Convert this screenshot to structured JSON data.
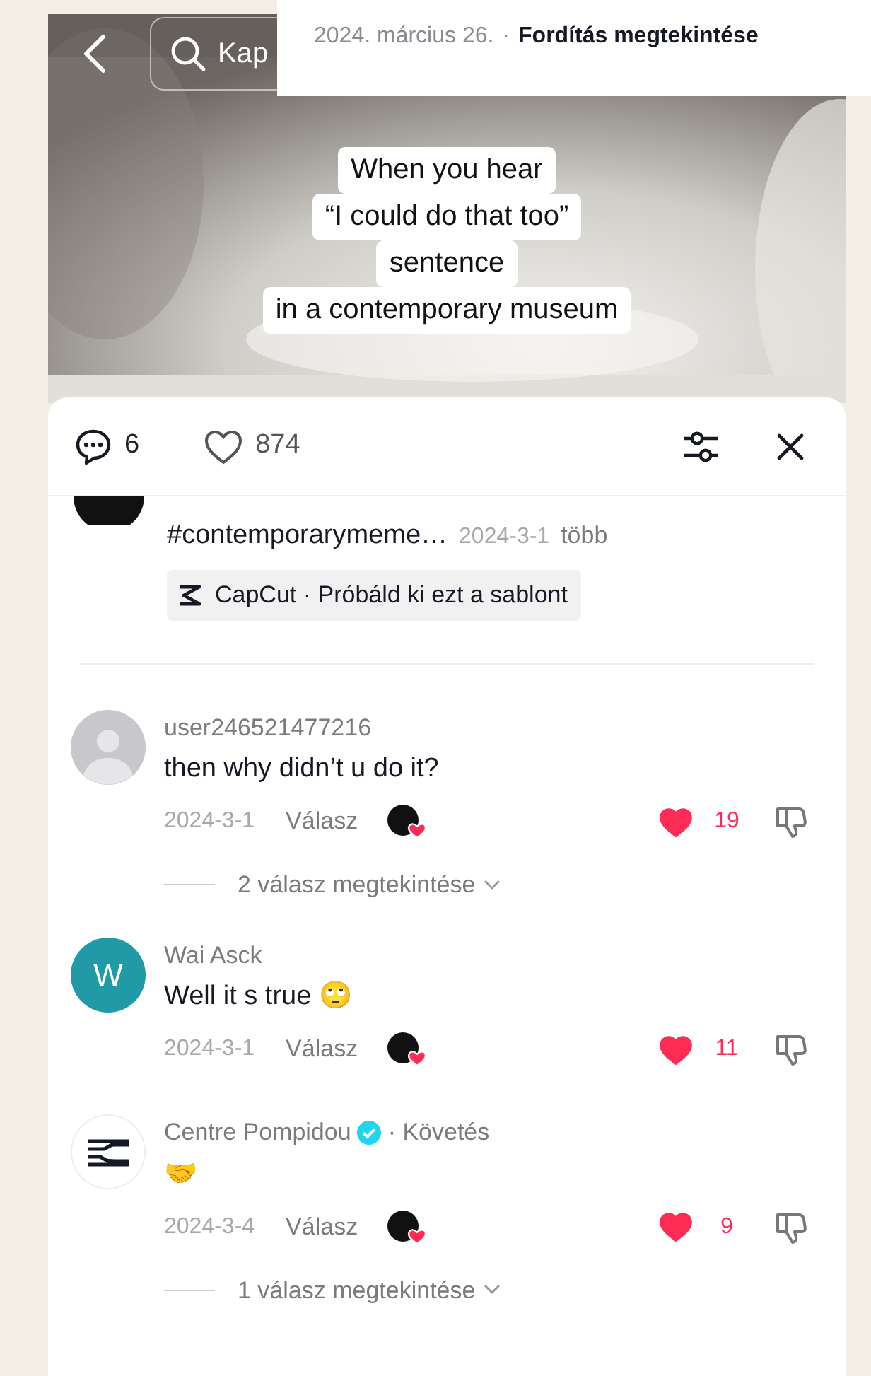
{
  "top_overlay": {
    "date": "2024. március 26.",
    "separator": "·",
    "link": "Fordítás megtekintése"
  },
  "search": {
    "placeholder": "Kap"
  },
  "video": {
    "kind": "picture",
    "caption_lines": [
      "When you hear",
      "“I could do that too”",
      "sentence",
      "in a contemporary museum"
    ]
  },
  "sheet": {
    "comment_count": "6",
    "like_count": "874"
  },
  "description": {
    "line_2": "#contemporarymeme…",
    "date": "2024-3-1",
    "more": "több",
    "template": "CapCut · Próbáld ki ezt a sablont"
  },
  "comments": [
    {
      "kind": "guest",
      "username": "user246521477216",
      "verified": false,
      "text": "then why didn’t u do it?",
      "date": "2024-3-1",
      "reply": "Válasz",
      "liked_by_creator": true,
      "liked": true,
      "likes": "19",
      "replies": "2 válasz megtekintése"
    },
    {
      "kind": "member",
      "avatar_letter": "W",
      "color": "#1f9aa6",
      "username": "Wai Asck",
      "verified": false,
      "text": "Well it s true 🙄",
      "date": "2024-3-1",
      "reply": "Válasz",
      "liked_by_creator": true,
      "liked": true,
      "likes": "11"
    },
    {
      "kind": "brand",
      "username": "Centre Pompidou",
      "verified": true,
      "follow": "· Követés",
      "text": "🤝",
      "date": "2024-3-4",
      "reply": "Válasz",
      "liked_by_creator": true,
      "liked": true,
      "likes": "9",
      "replies": "1 válasz megtekintése"
    }
  ]
}
